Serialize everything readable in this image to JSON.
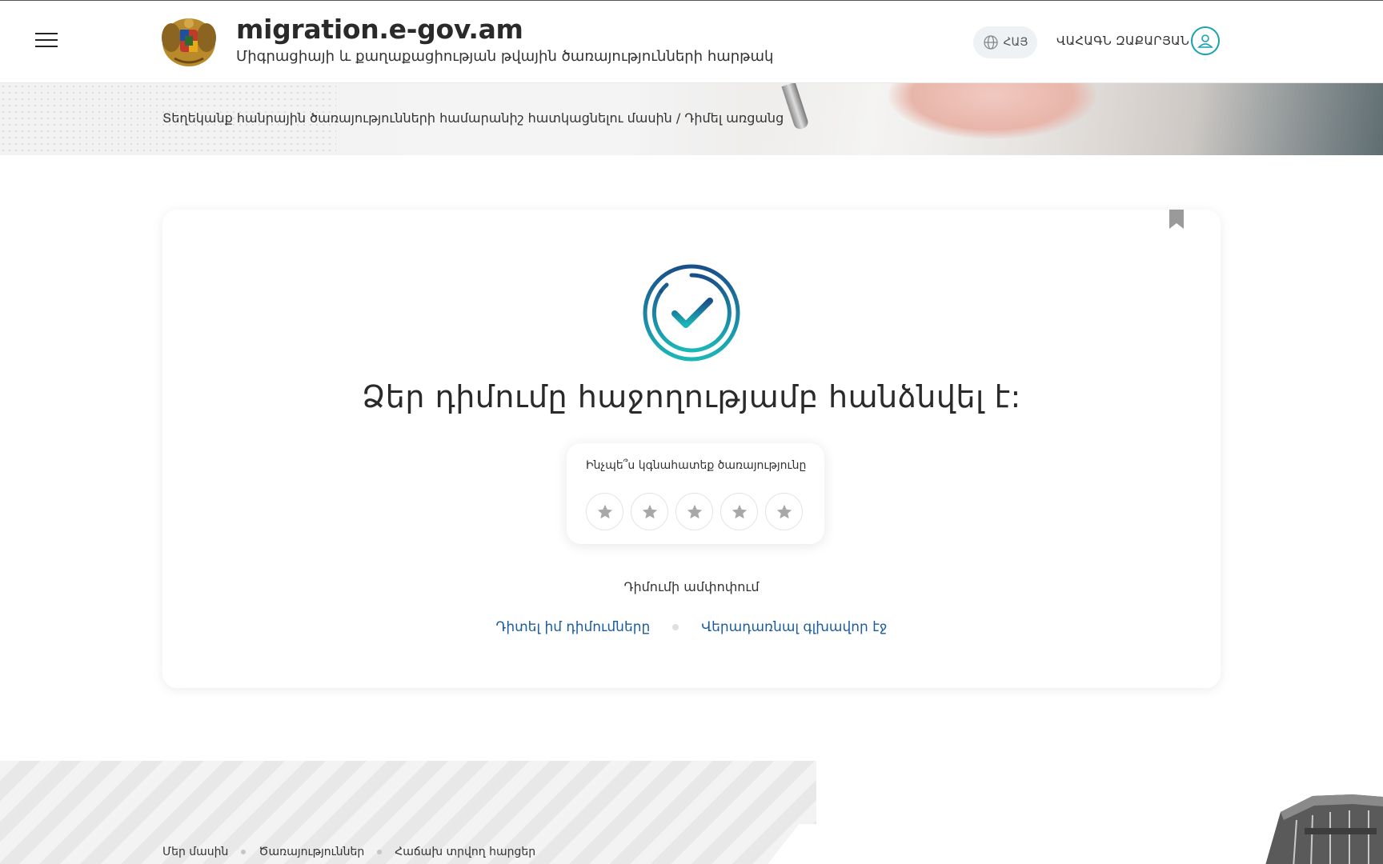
{
  "header": {
    "site_title": "migration.e-gov.am",
    "site_subtitle": "Միգրացիայի և քաղաքացիության թվային ծառայությունների հարթակ",
    "language_label": "ՀԱՅ",
    "user_name": "ՎԱՀԱԳՆ ԶԱՔԱՐՅԱՆ"
  },
  "breadcrumb": {
    "parent": "Տեղեկանք հանրային ծառայությունների համարանիշ հատկացնելու մասին",
    "separator": " / ",
    "current": "Դիմել առցանց"
  },
  "result": {
    "title": "Ձեր դիմումը հաջողությամբ հանձնվել է:",
    "rating_question": "Ինչպե՞ս կգնահատեք ծառայությունը",
    "rating_max": 5,
    "rating_value": 0,
    "summary_link": "Դիմումի ամփոփում",
    "view_applications": "Դիտել իմ դիմումները",
    "back_home": "Վերադառնալ գլխավոր էջ"
  },
  "footer": {
    "links": [
      "Մեր մասին",
      "Ծառայություններ",
      "Հաճախ տրվող հարցեր"
    ]
  },
  "colors": {
    "accent_teal": "#17a2b0",
    "link_blue": "#1a5c9e",
    "icon_dark_blue": "#1a4f8a"
  },
  "icons": {
    "menu": "hamburger-menu-icon",
    "emblem": "coat-of-arms-armenia",
    "language": "globe-icon",
    "user": "user-icon",
    "bookmark": "bookmark-icon",
    "success": "check-circle-icon",
    "rating": "star-icon"
  }
}
